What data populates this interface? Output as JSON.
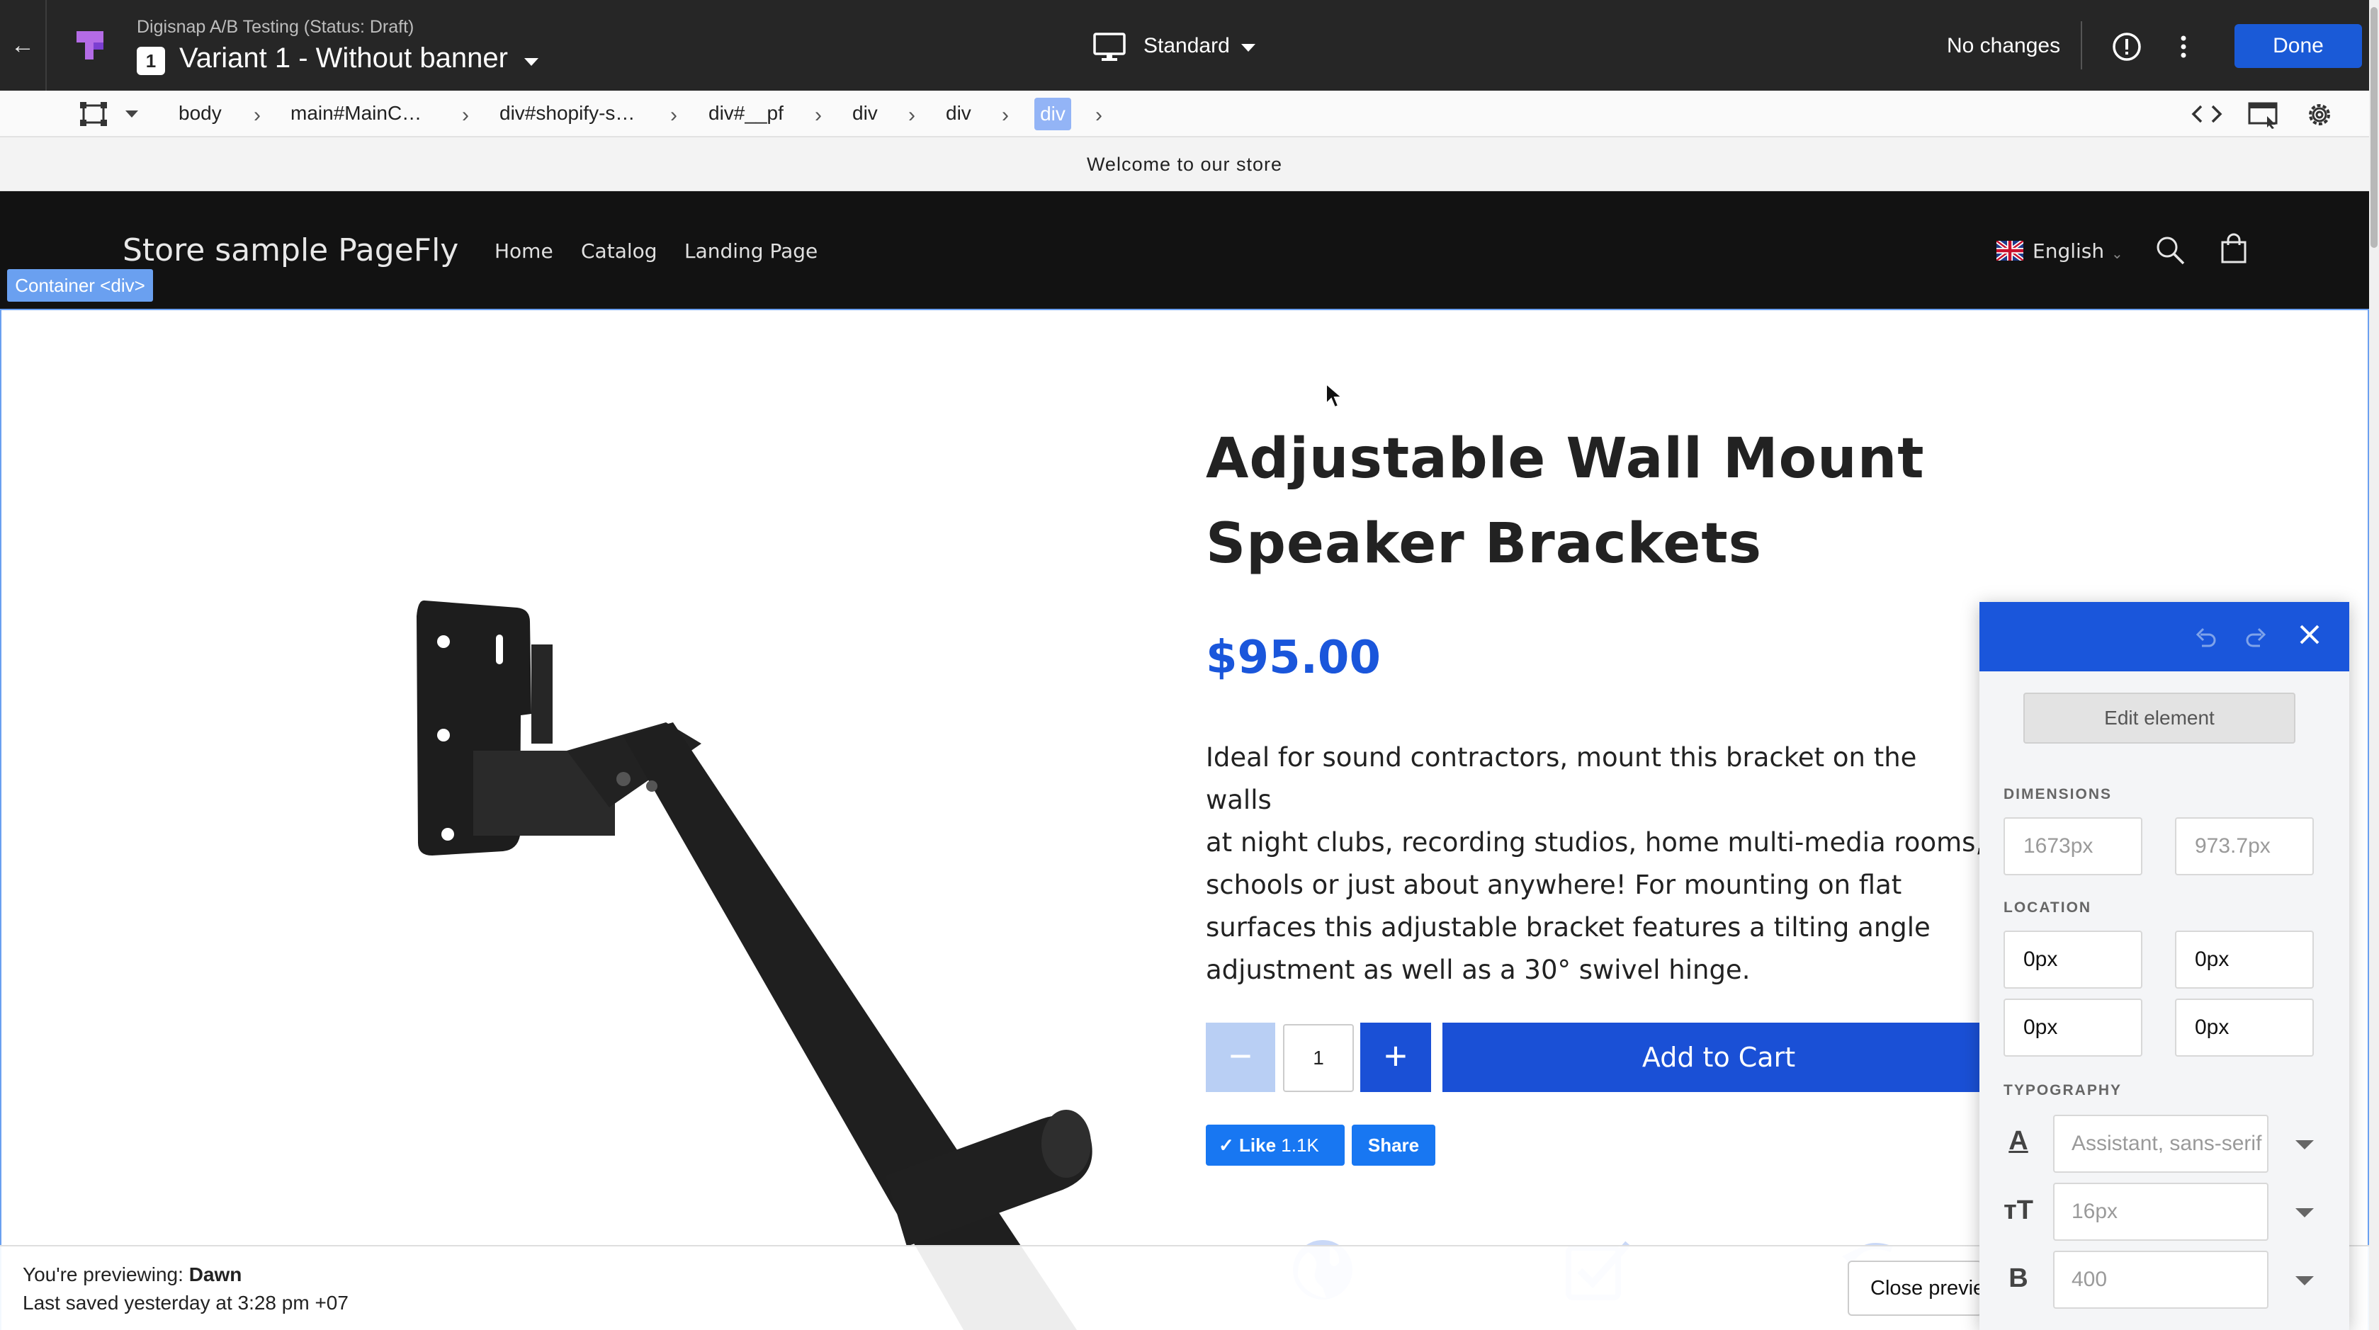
{
  "editor": {
    "app_name": "Digisnap A/B Testing (Status: Draft)",
    "variant_number": "1",
    "variant_title": "Variant 1 - Without banner",
    "device_label": "Standard",
    "status_text": "No changes",
    "done_label": "Done"
  },
  "breadcrumb": {
    "items": [
      "body",
      "main#MainC…",
      "div#shopify-s…",
      "div#__pf",
      "div",
      "div"
    ],
    "active": "div"
  },
  "store": {
    "announcement": "Welcome to our store",
    "name": "Store sample PageFly",
    "nav": [
      "Home",
      "Catalog",
      "Landing Page"
    ],
    "language": "English"
  },
  "selection": {
    "tag": "Container <div>"
  },
  "product": {
    "title_line1": "Adjustable Wall Mount",
    "title_line2": "Speaker Brackets",
    "price": "$95.00",
    "description_lines": [
      "Ideal for sound contractors, mount this bracket on the walls",
      "at night clubs, recording studios, home multi-media rooms,",
      "schools or just about anywhere! For mounting on flat",
      "surfaces this adjustable bracket features a tilting angle",
      "adjustment as well as a 30° swivel hinge."
    ],
    "quantity": "1",
    "minus_symbol": "−",
    "plus_symbol": "+",
    "add_to_cart_label": "Add to Cart",
    "like_label": "Like",
    "like_count": "1.1K",
    "share_label": "Share"
  },
  "preview_bar": {
    "previewing_prefix": "You're previewing: ",
    "theme_name": "Dawn",
    "last_saved": "Last saved yesterday at 3:28 pm +07",
    "close_label": "Close preview"
  },
  "edit_panel": {
    "edit_element_label": "Edit element",
    "dimensions_label": "DIMENSIONS",
    "width_placeholder": "1673px",
    "height_placeholder": "973.7px",
    "location_label": "LOCATION",
    "location_values": [
      "0px",
      "0px",
      "0px",
      "0px"
    ],
    "typography_label": "TYPOGRAPHY",
    "font_family_placeholder": "Assistant, sans-serif",
    "font_size_placeholder": "16px",
    "font_weight_placeholder": "400"
  },
  "colors": {
    "editor_bar": "#262626",
    "accent_blue": "#1a56db",
    "selection_blue": "#6aa0f0",
    "store_header": "#121212"
  }
}
